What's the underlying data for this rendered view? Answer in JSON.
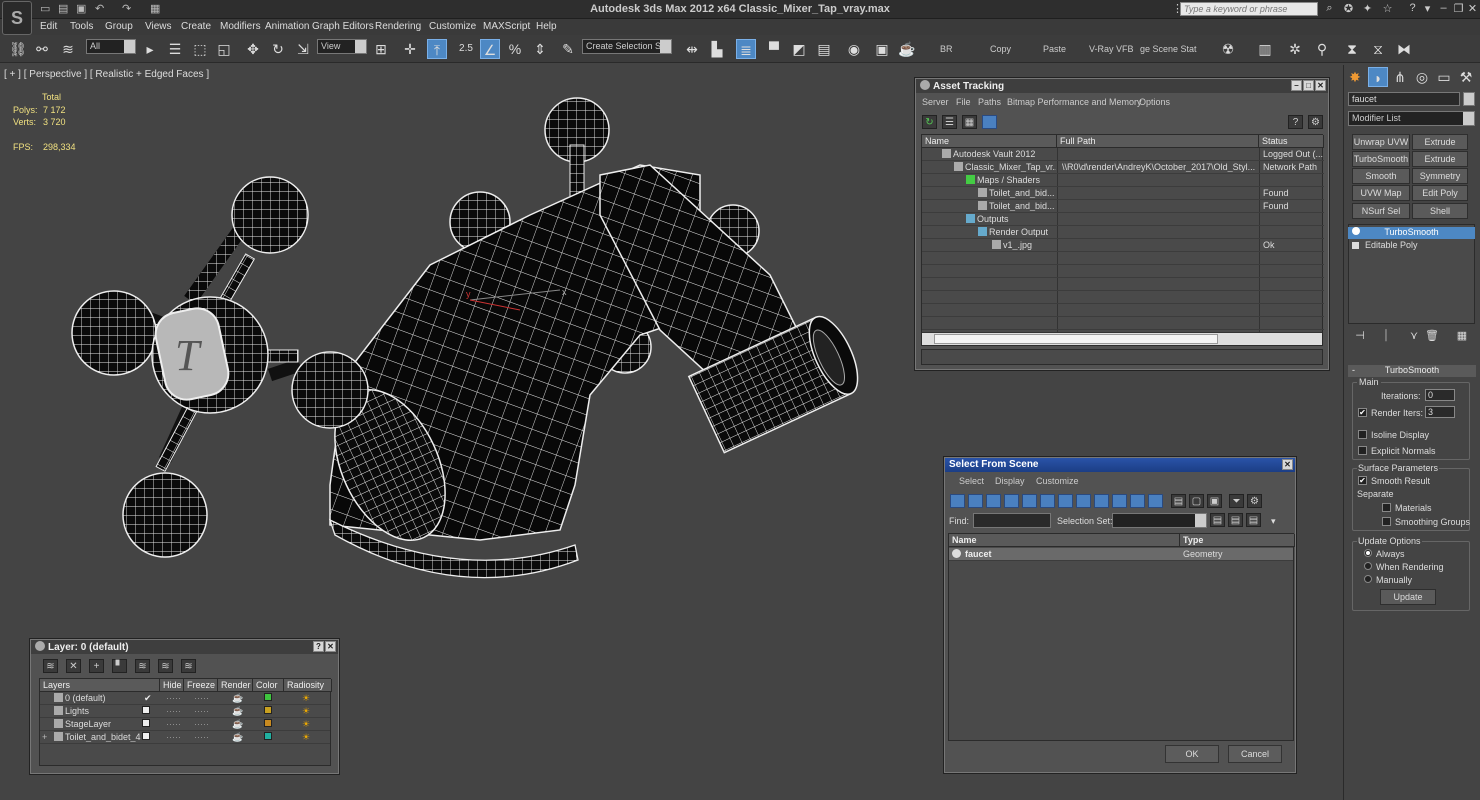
{
  "app": {
    "title": "Autodesk 3ds Max  2012 x64      Classic_Mixer_Tap_vray.max",
    "logo": "S",
    "search_placeholder": "Type a keyword or phrase",
    "menus": [
      "Edit",
      "Tools",
      "Group",
      "Views",
      "Create",
      "Modifiers",
      "Animation",
      "Graph Editors",
      "Rendering",
      "Customize",
      "MAXScript",
      "Help"
    ]
  },
  "toolbar": {
    "filter": "All",
    "ref_coord": "View",
    "snap_value": "2.5",
    "named_sel": "Create Selection Se",
    "br": "BR",
    "copy": "Copy",
    "paste": "Paste",
    "vfb": "V-Ray VFB",
    "scene_states": "ge Scene Stat"
  },
  "viewport": {
    "label": "[ + ] [ Perspective ] [ Realistic + Edged Faces ]",
    "stats": {
      "total_label": "Total",
      "polys_label": "Polys:",
      "polys": "7 172",
      "verts_label": "Verts:",
      "verts": "3 720",
      "fps_label": "FPS:",
      "fps": "298,334"
    },
    "axis_x": "x",
    "axis_y": "y"
  },
  "asset_tracking": {
    "title": "Asset Tracking",
    "menus": [
      "Server",
      "File",
      "Paths",
      "Bitmap Performance and Memory",
      "Options"
    ],
    "columns": [
      "Name",
      "Full Path",
      "Status"
    ],
    "rows": [
      {
        "name": "Autodesk Vault 2012",
        "path": "",
        "status": "Logged Out (..."
      },
      {
        "name": "Classic_Mixer_Tap_vr...",
        "path": "\\\\R0\\d\\render\\AndreyK\\October_2017\\Old_Styl...",
        "status": "Network Path"
      },
      {
        "name": "Maps / Shaders",
        "path": "",
        "status": ""
      },
      {
        "name": "Toilet_and_bid...",
        "path": "",
        "status": "Found"
      },
      {
        "name": "Toilet_and_bid...",
        "path": "",
        "status": "Found"
      },
      {
        "name": "Outputs",
        "path": "",
        "status": ""
      },
      {
        "name": "Render Output",
        "path": "",
        "status": ""
      },
      {
        "name": "v1_.jpg",
        "path": "",
        "status": "Ok"
      }
    ]
  },
  "select_from_scene": {
    "title": "Select From Scene",
    "menus": [
      "Select",
      "Display",
      "Customize"
    ],
    "find_label": "Find:",
    "selset_label": "Selection Set:",
    "columns": [
      "Name",
      "Type"
    ],
    "rows": [
      {
        "name": "faucet",
        "type": "Geometry"
      }
    ],
    "ok": "OK",
    "cancel": "Cancel"
  },
  "layer": {
    "title": "Layer: 0 (default)",
    "columns": [
      "Layers",
      "Hide",
      "Freeze",
      "Render",
      "Color",
      "Radiosity"
    ],
    "rows": [
      {
        "name": "0 (default)",
        "color": "#3ec43e",
        "active": "✔"
      },
      {
        "name": "Lights",
        "color": "#c8a020",
        "active": ""
      },
      {
        "name": "StageLayer",
        "color": "#c88a20",
        "active": ""
      },
      {
        "name": "Toilet_and_bidet_4",
        "color": "#20b0a0",
        "active": "",
        "expander": "+"
      }
    ],
    "dots": "·····"
  },
  "command_panel": {
    "object_name": "faucet",
    "modifier_list": "Modifier List",
    "buttons": [
      "Unwrap UVW",
      "Extrude",
      "TurboSmooth",
      "Extrude",
      "Smooth",
      "Symmetry",
      "UVW Map",
      "Edit Poly",
      "NSurf Sel",
      "Shell"
    ],
    "stack": [
      "TurboSmooth",
      "Editable Poly"
    ],
    "rollout_title": "TurboSmooth",
    "main_label": "Main",
    "iterations_label": "Iterations:",
    "iterations": "0",
    "render_iters_label": "Render Iters:",
    "render_iters": "3",
    "isoline": "Isoline Display",
    "explicit_normals": "Explicit Normals",
    "surface_params": "Surface Parameters",
    "smooth_result": "Smooth Result",
    "separate": "Separate",
    "materials": "Materials",
    "smoothing_groups": "Smoothing Groups",
    "update_options": "Update Options",
    "always": "Always",
    "when_rendering": "When Rendering",
    "manually": "Manually",
    "update": "Update",
    "minus": "-",
    "check": "✔"
  },
  "colors": {
    "accent": "#4d88c4",
    "title_blue": "#2a53a8",
    "bg": "#444444"
  }
}
